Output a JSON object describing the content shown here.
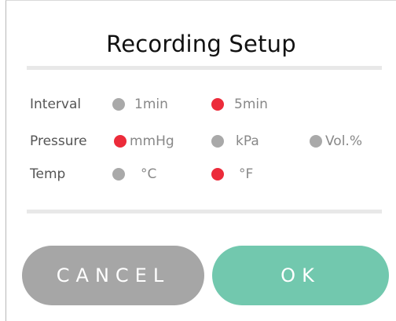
{
  "dialog": {
    "title": "Recording Setup"
  },
  "settings": {
    "interval": {
      "label": "Interval",
      "options": [
        {
          "label": "1min",
          "selected": false
        },
        {
          "label": "5min",
          "selected": true
        }
      ]
    },
    "pressure": {
      "label": "Pressure",
      "options": [
        {
          "label": "mmHg",
          "selected": true
        },
        {
          "label": "kPa",
          "selected": false
        },
        {
          "label": "Vol.%",
          "selected": false
        }
      ]
    },
    "temp": {
      "label": "Temp",
      "options": [
        {
          "label": "°C",
          "selected": false
        },
        {
          "label": "°F",
          "selected": true
        }
      ]
    }
  },
  "buttons": {
    "cancel_label": "CANCEL",
    "ok_label": "OK"
  },
  "colors": {
    "selected": "#ec2b3a",
    "unselected": "#a9a9a9",
    "ok_button": "#72c8ae",
    "cancel_button": "#a6a6a6"
  }
}
